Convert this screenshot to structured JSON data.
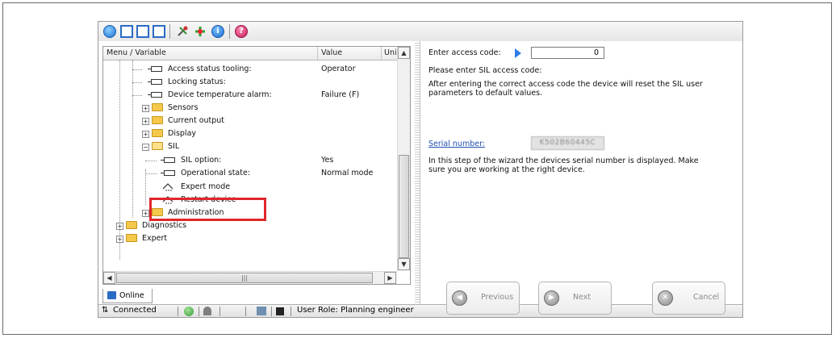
{
  "header": {
    "col_menu": "Menu / Variable",
    "col_value": "Value",
    "col_unit": "Uni"
  },
  "tree": [
    {
      "label": "Access status tooling:",
      "value": "Operator",
      "icon": "parameter-icon"
    },
    {
      "label": "Locking status:",
      "value": "",
      "icon": "parameter-icon"
    },
    {
      "label": "Device temperature alarm:",
      "value": "Failure (F)",
      "icon": "parameter-icon"
    },
    {
      "label": "Sensors",
      "value": "",
      "icon": "folder-icon"
    },
    {
      "label": "Current output",
      "value": "",
      "icon": "folder-icon"
    },
    {
      "label": "Display",
      "value": "",
      "icon": "folder-icon"
    },
    {
      "label": "SIL",
      "value": "",
      "icon": "folder-open-icon"
    },
    {
      "label": "SIL option:",
      "value": "Yes",
      "icon": "parameter-icon"
    },
    {
      "label": "Operational state:",
      "value": "Normal mode",
      "icon": "parameter-icon"
    },
    {
      "label": "Expert mode",
      "value": "",
      "icon": "wizard-icon"
    },
    {
      "label": "Restart device",
      "value": "",
      "icon": "wizard-icon"
    },
    {
      "label": "Administration",
      "value": "",
      "icon": "folder-icon"
    },
    {
      "label": "Diagnostics",
      "value": "",
      "icon": "folder-icon"
    },
    {
      "label": "Expert",
      "value": "",
      "icon": "folder-icon"
    }
  ],
  "tabs": {
    "online": "Online"
  },
  "status": {
    "connected": "Connected",
    "user_role": "User Role: Planning engineer"
  },
  "wizard": {
    "access_code_label": "Enter access code:",
    "access_code_value": "0",
    "prompt": "Please enter SIL access code:",
    "info1_line1": "After entering the correct access code the device will reset the SIL user",
    "info1_line2": "parameters to default values.",
    "serial_label": "Serial number:",
    "serial_value": "K502B60445C",
    "info2_line1": "In this step of the wizard the devices serial number is displayed. Make",
    "info2_line2": "sure you are working at the right device.",
    "btn_previous": "Previous",
    "btn_next": "Next",
    "btn_cancel": "Cancel"
  },
  "colors": {
    "highlight": "#e0262a",
    "link": "#1f4fb3",
    "arrow": "#2d7ee6"
  }
}
